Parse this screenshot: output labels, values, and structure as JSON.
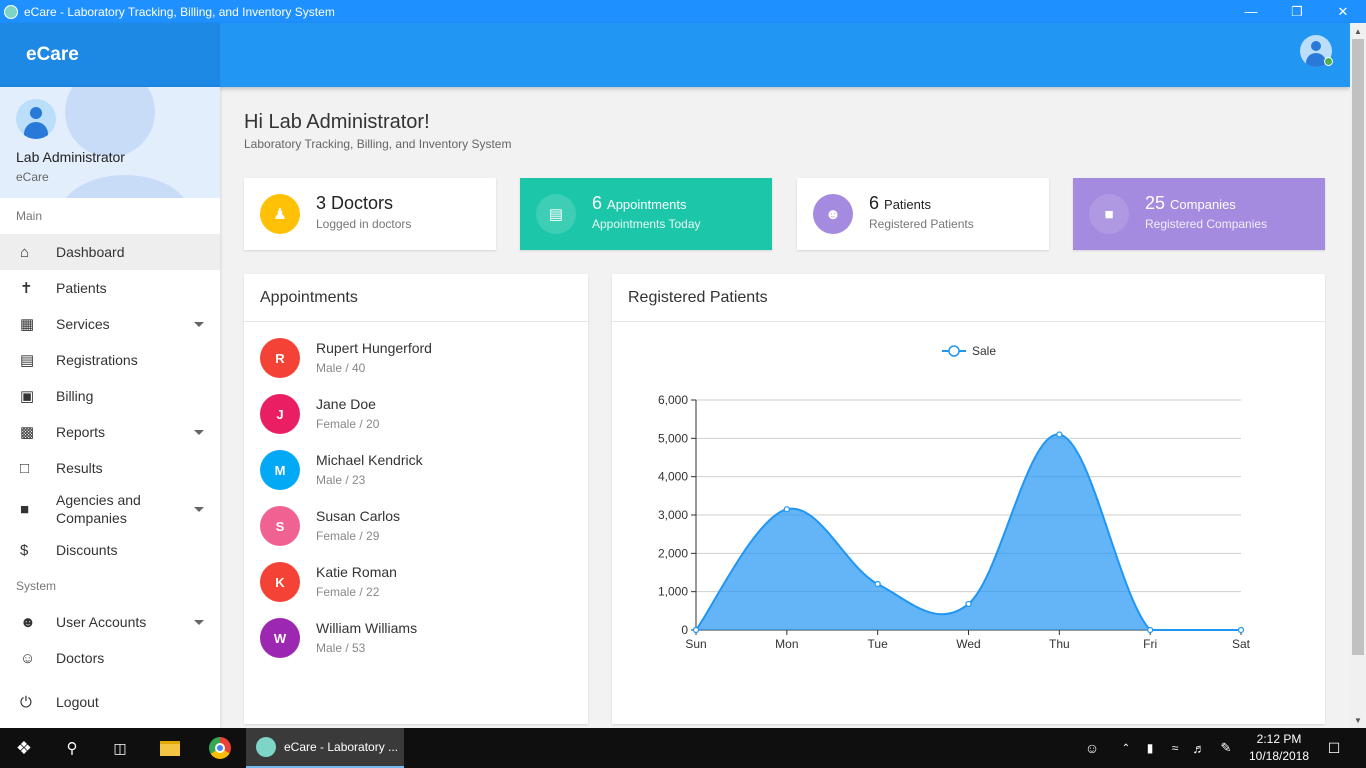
{
  "window": {
    "title": "eCare - Laboratory Tracking, Billing, and Inventory System"
  },
  "app": {
    "brand": "eCare"
  },
  "profile": {
    "name": "Lab Administrator",
    "org": "eCare"
  },
  "sidebar": {
    "main_label": "Main",
    "main_items": [
      {
        "label": "Dashboard",
        "icon": "home-icon",
        "active": true
      },
      {
        "label": "Patients",
        "icon": "person-icon"
      },
      {
        "label": "Services",
        "icon": "dashboard-icon",
        "expandable": true
      },
      {
        "label": "Registrations",
        "icon": "clipboard-icon"
      },
      {
        "label": "Billing",
        "icon": "wallet-icon"
      },
      {
        "label": "Reports",
        "icon": "bar-chart-icon",
        "expandable": true
      },
      {
        "label": "Results",
        "icon": "pdf-icon"
      },
      {
        "label": "Agencies and Companies",
        "icon": "store-icon",
        "expandable": true
      },
      {
        "label": "Discounts",
        "icon": "discount-icon"
      }
    ],
    "system_label": "System",
    "system_items": [
      {
        "label": "User Accounts",
        "icon": "people-icon",
        "expandable": true
      },
      {
        "label": "Doctors",
        "icon": "doctor-icon"
      },
      {
        "label": "Logout",
        "icon": "power-icon"
      }
    ]
  },
  "greeting": {
    "title": "Hi Lab Administrator!",
    "subtitle": "Laboratory Tracking, Billing, and Inventory System"
  },
  "cards": {
    "doctors": {
      "count": "3",
      "unit": "Doctors",
      "desc": "Logged in doctors",
      "color": "#ffc107"
    },
    "appointments": {
      "count": "6",
      "unit": "Appointments",
      "desc": "Appointments Today",
      "color": "#1cc6a8"
    },
    "patients": {
      "count": "6",
      "unit": "Patients",
      "desc": "Registered Patients",
      "color": "#a48be0"
    },
    "companies": {
      "count": "25",
      "unit": "Companies",
      "desc": "Registered Companies",
      "color": "#a48be0"
    }
  },
  "appointments_panel": {
    "title": "Appointments",
    "items": [
      {
        "initial": "R",
        "name": "Rupert Hungerford",
        "meta": "Male / 40",
        "color": "#f44336"
      },
      {
        "initial": "J",
        "name": "Jane Doe",
        "meta": "Female / 20",
        "color": "#e91e63"
      },
      {
        "initial": "M",
        "name": "Michael Kendrick",
        "meta": "Male / 23",
        "color": "#03a9f4"
      },
      {
        "initial": "S",
        "name": "Susan Carlos",
        "meta": "Female / 29",
        "color": "#f06292"
      },
      {
        "initial": "K",
        "name": "Katie Roman",
        "meta": "Female / 22",
        "color": "#f44336"
      },
      {
        "initial": "W",
        "name": "William Williams",
        "meta": "Male / 53",
        "color": "#9c27b0"
      }
    ]
  },
  "patients_panel": {
    "title": "Registered Patients"
  },
  "chart_data": {
    "type": "area",
    "categories": [
      "Sun",
      "Mon",
      "Tue",
      "Wed",
      "Thu",
      "Fri",
      "Sat"
    ],
    "series": [
      {
        "name": "Sale",
        "values": [
          0,
          3150,
          1200,
          680,
          5100,
          0,
          0
        ],
        "color": "#2196f3"
      }
    ],
    "ylim": [
      0,
      6000
    ],
    "yticks": [
      "0",
      "1,000",
      "2,000",
      "3,000",
      "4,000",
      "5,000",
      "6,000"
    ],
    "grid": true,
    "legend": "top"
  },
  "taskbar": {
    "app_label": "eCare - Laboratory ...",
    "time": "2:12 PM",
    "date": "10/18/2018"
  }
}
